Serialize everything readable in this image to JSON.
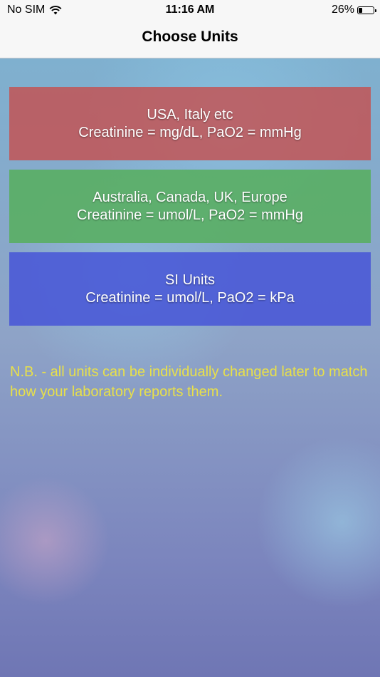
{
  "status_bar": {
    "carrier": "No SIM",
    "time": "11:16 AM",
    "battery_percent": "26%",
    "battery_level": 0.26,
    "wifi_icon": "wifi-icon",
    "battery_icon": "battery-icon"
  },
  "nav": {
    "title": "Choose Units"
  },
  "options": [
    {
      "title": "USA, Italy etc",
      "subtitle": "Creatinine = mg/dL, PaO2 = mmHg",
      "color": "#c45050"
    },
    {
      "title": "Australia, Canada, UK, Europe",
      "subtitle": "Creatinine = umol/L, PaO2 = mmHg",
      "color": "#58ae60"
    },
    {
      "title": "SI Units",
      "subtitle": "Creatinine = umol/L, PaO2 = kPa",
      "color": "#4655d7"
    }
  ],
  "note": "N.B. - all units can be individually changed later to match how your laboratory reports them.",
  "colors": {
    "note_text": "#e8e04a",
    "nav_background": "#f7f7f7"
  }
}
